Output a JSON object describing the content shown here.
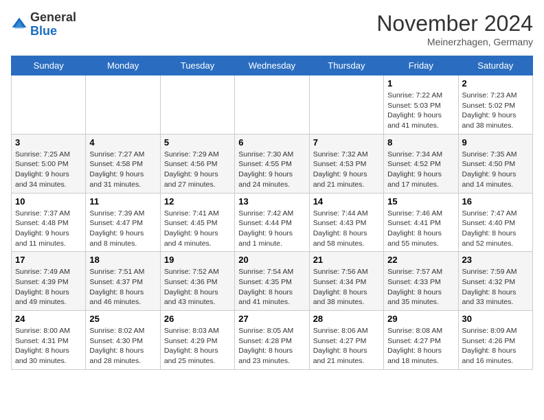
{
  "logo": {
    "general": "General",
    "blue": "Blue"
  },
  "header": {
    "month": "November 2024",
    "location": "Meinerzhagen, Germany"
  },
  "weekdays": [
    "Sunday",
    "Monday",
    "Tuesday",
    "Wednesday",
    "Thursday",
    "Friday",
    "Saturday"
  ],
  "weeks": [
    [
      {
        "day": "",
        "info": ""
      },
      {
        "day": "",
        "info": ""
      },
      {
        "day": "",
        "info": ""
      },
      {
        "day": "",
        "info": ""
      },
      {
        "day": "",
        "info": ""
      },
      {
        "day": "1",
        "info": "Sunrise: 7:22 AM\nSunset: 5:03 PM\nDaylight: 9 hours and 41 minutes."
      },
      {
        "day": "2",
        "info": "Sunrise: 7:23 AM\nSunset: 5:02 PM\nDaylight: 9 hours and 38 minutes."
      }
    ],
    [
      {
        "day": "3",
        "info": "Sunrise: 7:25 AM\nSunset: 5:00 PM\nDaylight: 9 hours and 34 minutes."
      },
      {
        "day": "4",
        "info": "Sunrise: 7:27 AM\nSunset: 4:58 PM\nDaylight: 9 hours and 31 minutes."
      },
      {
        "day": "5",
        "info": "Sunrise: 7:29 AM\nSunset: 4:56 PM\nDaylight: 9 hours and 27 minutes."
      },
      {
        "day": "6",
        "info": "Sunrise: 7:30 AM\nSunset: 4:55 PM\nDaylight: 9 hours and 24 minutes."
      },
      {
        "day": "7",
        "info": "Sunrise: 7:32 AM\nSunset: 4:53 PM\nDaylight: 9 hours and 21 minutes."
      },
      {
        "day": "8",
        "info": "Sunrise: 7:34 AM\nSunset: 4:52 PM\nDaylight: 9 hours and 17 minutes."
      },
      {
        "day": "9",
        "info": "Sunrise: 7:35 AM\nSunset: 4:50 PM\nDaylight: 9 hours and 14 minutes."
      }
    ],
    [
      {
        "day": "10",
        "info": "Sunrise: 7:37 AM\nSunset: 4:48 PM\nDaylight: 9 hours and 11 minutes."
      },
      {
        "day": "11",
        "info": "Sunrise: 7:39 AM\nSunset: 4:47 PM\nDaylight: 9 hours and 8 minutes."
      },
      {
        "day": "12",
        "info": "Sunrise: 7:41 AM\nSunset: 4:45 PM\nDaylight: 9 hours and 4 minutes."
      },
      {
        "day": "13",
        "info": "Sunrise: 7:42 AM\nSunset: 4:44 PM\nDaylight: 9 hours and 1 minute."
      },
      {
        "day": "14",
        "info": "Sunrise: 7:44 AM\nSunset: 4:43 PM\nDaylight: 8 hours and 58 minutes."
      },
      {
        "day": "15",
        "info": "Sunrise: 7:46 AM\nSunset: 4:41 PM\nDaylight: 8 hours and 55 minutes."
      },
      {
        "day": "16",
        "info": "Sunrise: 7:47 AM\nSunset: 4:40 PM\nDaylight: 8 hours and 52 minutes."
      }
    ],
    [
      {
        "day": "17",
        "info": "Sunrise: 7:49 AM\nSunset: 4:39 PM\nDaylight: 8 hours and 49 minutes."
      },
      {
        "day": "18",
        "info": "Sunrise: 7:51 AM\nSunset: 4:37 PM\nDaylight: 8 hours and 46 minutes."
      },
      {
        "day": "19",
        "info": "Sunrise: 7:52 AM\nSunset: 4:36 PM\nDaylight: 8 hours and 43 minutes."
      },
      {
        "day": "20",
        "info": "Sunrise: 7:54 AM\nSunset: 4:35 PM\nDaylight: 8 hours and 41 minutes."
      },
      {
        "day": "21",
        "info": "Sunrise: 7:56 AM\nSunset: 4:34 PM\nDaylight: 8 hours and 38 minutes."
      },
      {
        "day": "22",
        "info": "Sunrise: 7:57 AM\nSunset: 4:33 PM\nDaylight: 8 hours and 35 minutes."
      },
      {
        "day": "23",
        "info": "Sunrise: 7:59 AM\nSunset: 4:32 PM\nDaylight: 8 hours and 33 minutes."
      }
    ],
    [
      {
        "day": "24",
        "info": "Sunrise: 8:00 AM\nSunset: 4:31 PM\nDaylight: 8 hours and 30 minutes."
      },
      {
        "day": "25",
        "info": "Sunrise: 8:02 AM\nSunset: 4:30 PM\nDaylight: 8 hours and 28 minutes."
      },
      {
        "day": "26",
        "info": "Sunrise: 8:03 AM\nSunset: 4:29 PM\nDaylight: 8 hours and 25 minutes."
      },
      {
        "day": "27",
        "info": "Sunrise: 8:05 AM\nSunset: 4:28 PM\nDaylight: 8 hours and 23 minutes."
      },
      {
        "day": "28",
        "info": "Sunrise: 8:06 AM\nSunset: 4:27 PM\nDaylight: 8 hours and 21 minutes."
      },
      {
        "day": "29",
        "info": "Sunrise: 8:08 AM\nSunset: 4:27 PM\nDaylight: 8 hours and 18 minutes."
      },
      {
        "day": "30",
        "info": "Sunrise: 8:09 AM\nSunset: 4:26 PM\nDaylight: 8 hours and 16 minutes."
      }
    ]
  ]
}
